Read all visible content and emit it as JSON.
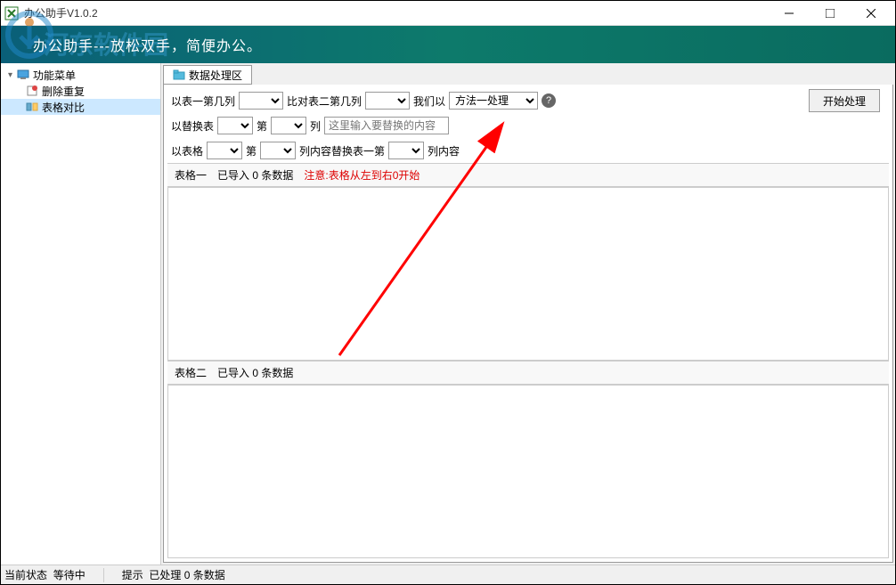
{
  "titlebar": {
    "title": "办公助手V1.0.2"
  },
  "banner": {
    "text": "办公助手---放松双手，简便办公。",
    "watermark": "河东软件园"
  },
  "sidebar": {
    "root": "功能菜单",
    "items": [
      {
        "label": "删除重复",
        "selected": false
      },
      {
        "label": "表格对比",
        "selected": true
      }
    ]
  },
  "tab": {
    "label": "数据处理区"
  },
  "options": {
    "row1": {
      "l1": "以表一第几列",
      "l2": "比对表二第几列",
      "l3": "我们以",
      "method": "方法一处理"
    },
    "row2": {
      "l1": "以替换表",
      "l2": "第",
      "l3": "列",
      "placeholder": "这里输入要替换的内容"
    },
    "row3": {
      "l1": "以表格",
      "l2": "第",
      "l3": "列内容替换表一第",
      "l4": "列内容"
    },
    "startBtn": "开始处理"
  },
  "section1": {
    "label": "表格一",
    "stat": "已导入 0 条数据",
    "warn": "注意:表格从左到右0开始"
  },
  "section2": {
    "label": "表格二",
    "stat": "已导入 0 条数据"
  },
  "statusbar": {
    "state_label": "当前状态",
    "state_value": "等待中",
    "hint_label": "提示",
    "hint_value": "已处理 0 条数据"
  }
}
